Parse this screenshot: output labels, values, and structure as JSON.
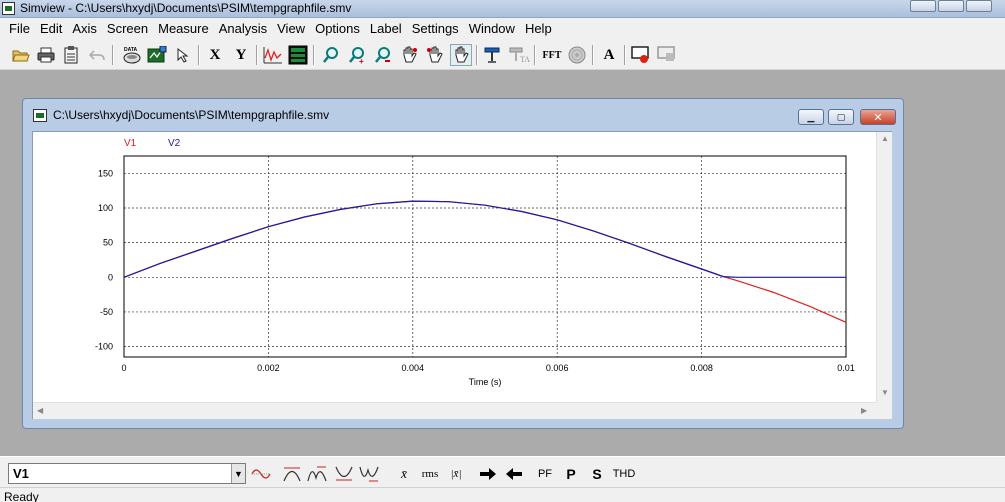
{
  "app": {
    "title": "Simview - C:\\Users\\hxydj\\Documents\\PSIM\\tempgraphfile.smv"
  },
  "menu": {
    "items": [
      "File",
      "Edit",
      "Axis",
      "Screen",
      "Measure",
      "Analysis",
      "View",
      "Options",
      "Label",
      "Settings",
      "Window",
      "Help"
    ]
  },
  "toolbar": {
    "x_label": "X",
    "y_label": "Y",
    "fft_label": "FFT",
    "text_label": "A",
    "data_label": "DATA"
  },
  "graph_window": {
    "title": "C:\\Users\\hxydj\\Documents\\PSIM\\tempgraphfile.smv"
  },
  "chart_data": {
    "type": "line",
    "title": "",
    "xlabel": "Time (s)",
    "ylabel": "",
    "xlim": [
      0,
      0.01
    ],
    "ylim": [
      -115,
      175
    ],
    "grid": true,
    "legend_placement": "top-left",
    "x_ticks": [
      "0",
      "0.002",
      "0.004",
      "0.006",
      "0.008",
      "0.01"
    ],
    "y_ticks": [
      "150",
      "100",
      "50",
      "0",
      "-50",
      "-100"
    ],
    "x": [
      0,
      0.0005,
      0.001,
      0.0015,
      0.002,
      0.0025,
      0.003,
      0.0035,
      0.004,
      0.0045,
      0.005,
      0.0055,
      0.006,
      0.0065,
      0.007,
      0.0075,
      0.008,
      0.0083,
      0.0085,
      0.009,
      0.0095,
      0.01
    ],
    "series": [
      {
        "name": "V1",
        "color": "#e0201e",
        "values": [
          0,
          20,
          38,
          56,
          73,
          87,
          98,
          106,
          110,
          109,
          104,
          95,
          83,
          67,
          49,
          30,
          12,
          1,
          -5,
          -22,
          -42,
          -65
        ]
      },
      {
        "name": "V2",
        "color": "#1a1aa8",
        "values": [
          0,
          20,
          38,
          56,
          73,
          87,
          98,
          106,
          110,
          109,
          104,
          95,
          83,
          67,
          49,
          30,
          12,
          1,
          0,
          0,
          0,
          0
        ]
      }
    ]
  },
  "bottom_toolbar": {
    "selected_curve": "V1",
    "mean_label": "x̄",
    "rms_label": "rms",
    "abs_mean_label": "|x̄|",
    "pf_label": "PF",
    "p_label": "P",
    "s_label": "S",
    "thd_label": "THD"
  },
  "status": {
    "text": "Ready"
  }
}
